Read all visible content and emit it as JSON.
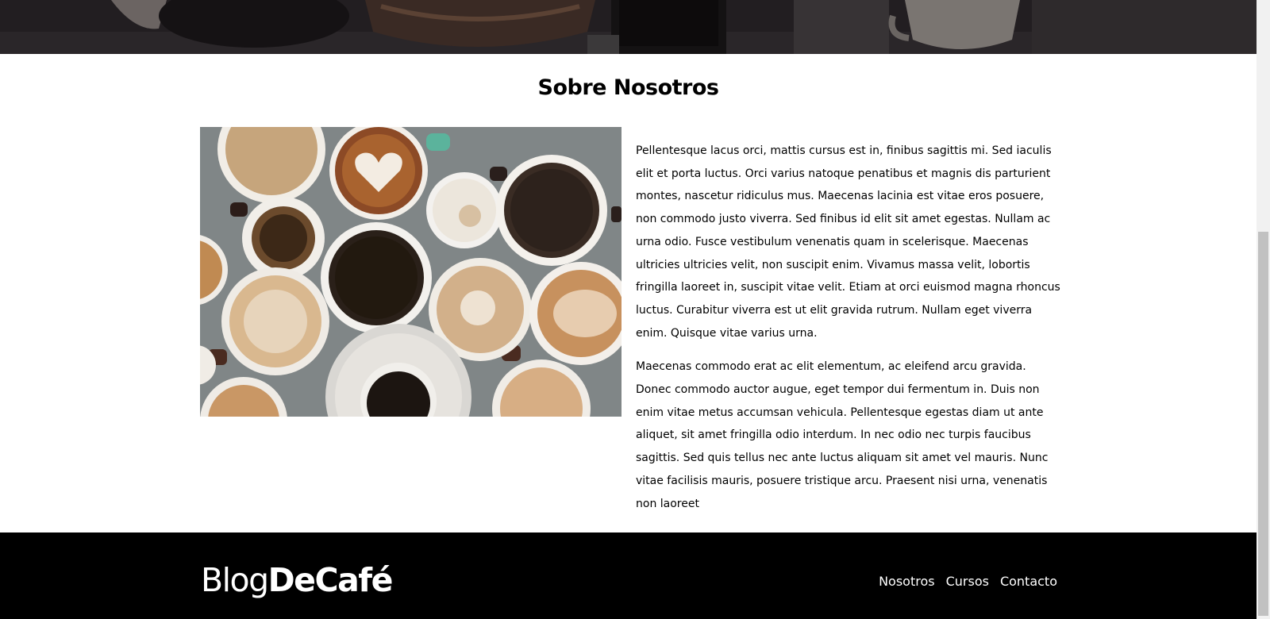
{
  "about": {
    "title": "Sobre Nosotros",
    "image_alt": "cups of coffee viewed from above",
    "paragraphs": [
      "Pellentesque lacus orci, mattis cursus est in, finibus sagittis mi. Sed iaculis elit et porta luctus. Orci varius natoque penatibus et magnis dis parturient montes, nascetur ridiculus mus. Maecenas lacinia est vitae eros posuere, non commodo justo viverra. Sed finibus id elit sit amet egestas. Nullam ac urna odio. Fusce vestibulum venenatis quam in scelerisque. Maecenas ultricies ultricies velit, non suscipit enim. Vivamus massa velit, lobortis fringilla laoreet in, suscipit vitae velit. Etiam at orci euismod magna rhoncus luctus. Curabitur viverra est ut elit gravida rutrum. Nullam eget viverra enim. Quisque vitae varius urna.",
      "Maecenas commodo erat ac elit elementum, ac eleifend arcu gravida. Donec commodo auctor augue, eget tempor dui fermentum in. Duis non enim vitae metus accumsan vehicula. Pellentesque egestas diam ut ante aliquet, sit amet fringilla odio interdum. In nec odio nec turpis faucibus sagittis. Sed quis tellus nec ante luctus aliquam sit amet vel mauris. Nunc vitae facilisis mauris, posuere tristique arcu. Praesent nisi urna, venenatis non laoreet"
    ]
  },
  "footer": {
    "logo_light": "Blog",
    "logo_bold": "DeCafé",
    "nav": [
      "Nosotros",
      "Cursos",
      "Contacto"
    ]
  },
  "colors": {
    "footer_bg": "#000000",
    "hero_bg": "#1e1b1e",
    "text": "#000000"
  }
}
